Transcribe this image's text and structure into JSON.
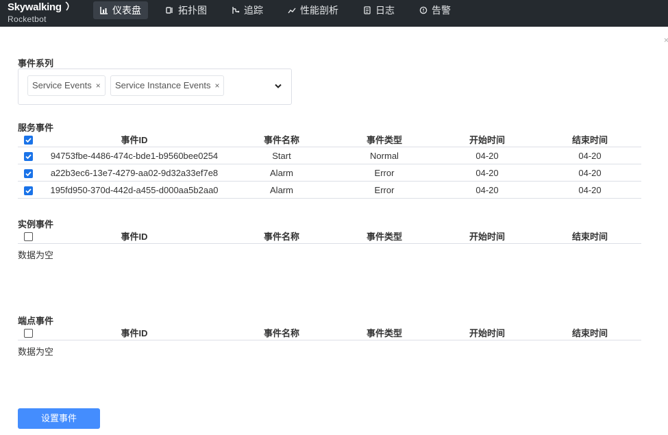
{
  "app": {
    "logo_main": "Skywalking",
    "logo_sub": "Rocketbot"
  },
  "nav": [
    {
      "label": "仪表盘",
      "icon": "dashboard-icon",
      "active": true
    },
    {
      "label": "拓扑图",
      "icon": "topology-icon",
      "active": false
    },
    {
      "label": "追踪",
      "icon": "trace-icon",
      "active": false
    },
    {
      "label": "性能剖析",
      "icon": "profile-icon",
      "active": false
    },
    {
      "label": "日志",
      "icon": "log-icon",
      "active": false
    },
    {
      "label": "告警",
      "icon": "alarm-icon",
      "active": false
    }
  ],
  "event_series": {
    "label": "事件系列",
    "tags": [
      "Service Events",
      "Service Instance Events"
    ],
    "remove_symbol": "×"
  },
  "columns": [
    "事件ID",
    "事件名称",
    "事件类型",
    "开始时间",
    "结束时间"
  ],
  "service_events": {
    "title": "服务事件",
    "all_checked": true,
    "rows": [
      {
        "id": "94753fbe-4486-474c-bde1-b9560bee0254",
        "name": "Start",
        "type": "Normal",
        "start": "04-20",
        "end": "04-20",
        "checked": true
      },
      {
        "id": "a22b3ec6-13e7-4279-aa02-9d32a33ef7e8",
        "name": "Alarm",
        "type": "Error",
        "start": "04-20",
        "end": "04-20",
        "checked": true
      },
      {
        "id": "195fd950-370d-442d-a455-d000aa5b2aa0",
        "name": "Alarm",
        "type": "Error",
        "start": "04-20",
        "end": "04-20",
        "checked": true
      }
    ]
  },
  "instance_events": {
    "title": "实例事件",
    "all_checked": false,
    "empty_text": "数据为空"
  },
  "endpoint_events": {
    "title": "端点事件",
    "all_checked": false,
    "empty_text": "数据为空"
  },
  "set_events_button": "设置事件",
  "colors": {
    "topbar": "#252a2f",
    "checkbox": "#1a73e8",
    "button": "#448dfe"
  }
}
